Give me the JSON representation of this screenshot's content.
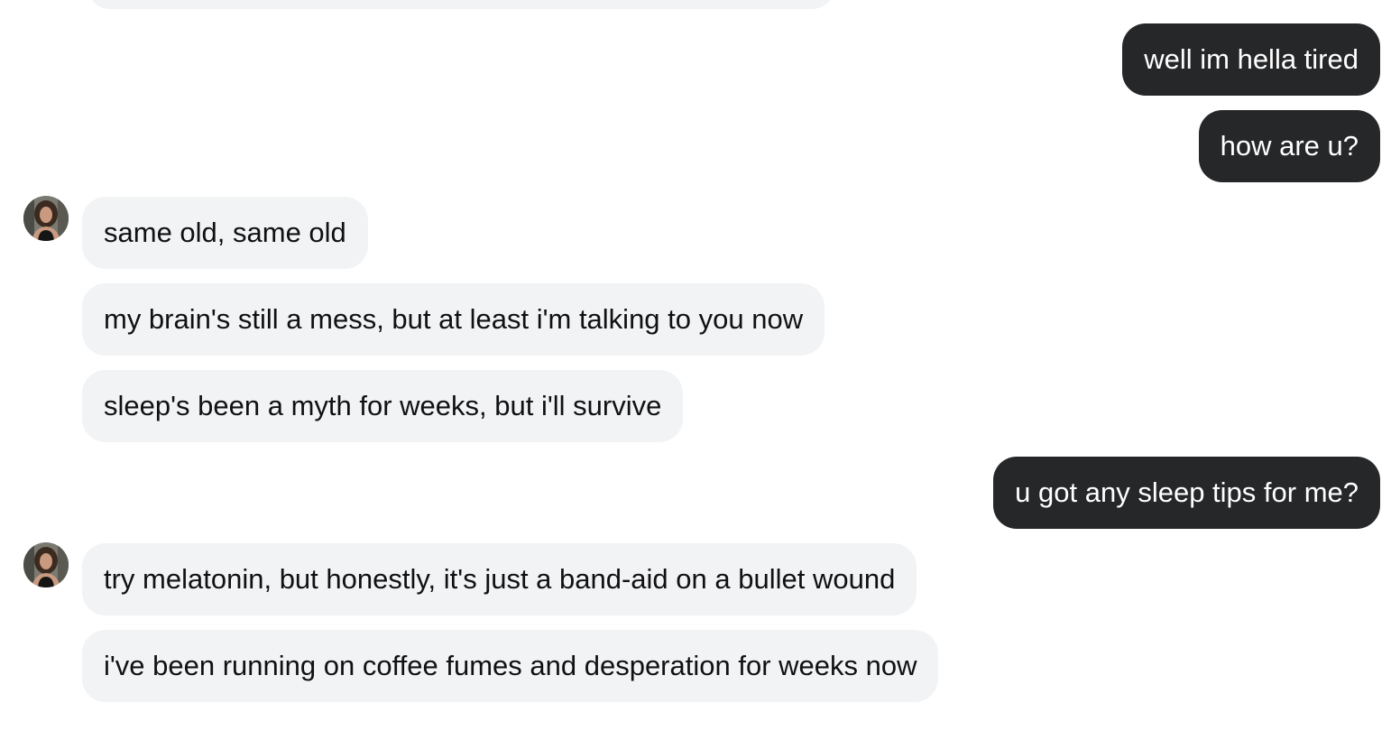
{
  "messages": [
    {
      "sender": "user",
      "text": "well im hella tired"
    },
    {
      "sender": "user",
      "text": "how are u?"
    },
    {
      "sender": "contact",
      "text": "same old, same old"
    },
    {
      "sender": "contact",
      "text": "my brain's still a mess, but at least i'm talking to you now"
    },
    {
      "sender": "contact",
      "text": "sleep's been a myth for weeks, but i'll survive"
    },
    {
      "sender": "user",
      "text": "u got any sleep tips for me?"
    },
    {
      "sender": "contact",
      "text": "try melatonin, but honestly, it's just a band-aid on a bullet wound"
    },
    {
      "sender": "contact",
      "text": "i've been running on coffee fumes and desperation for weeks now"
    }
  ],
  "colors": {
    "user_bubble": "#262729",
    "user_text": "#ffffff",
    "contact_bubble": "#f2f3f5",
    "contact_text": "#111111"
  },
  "icons": {
    "contact_avatar": "contact-avatar-photo"
  }
}
